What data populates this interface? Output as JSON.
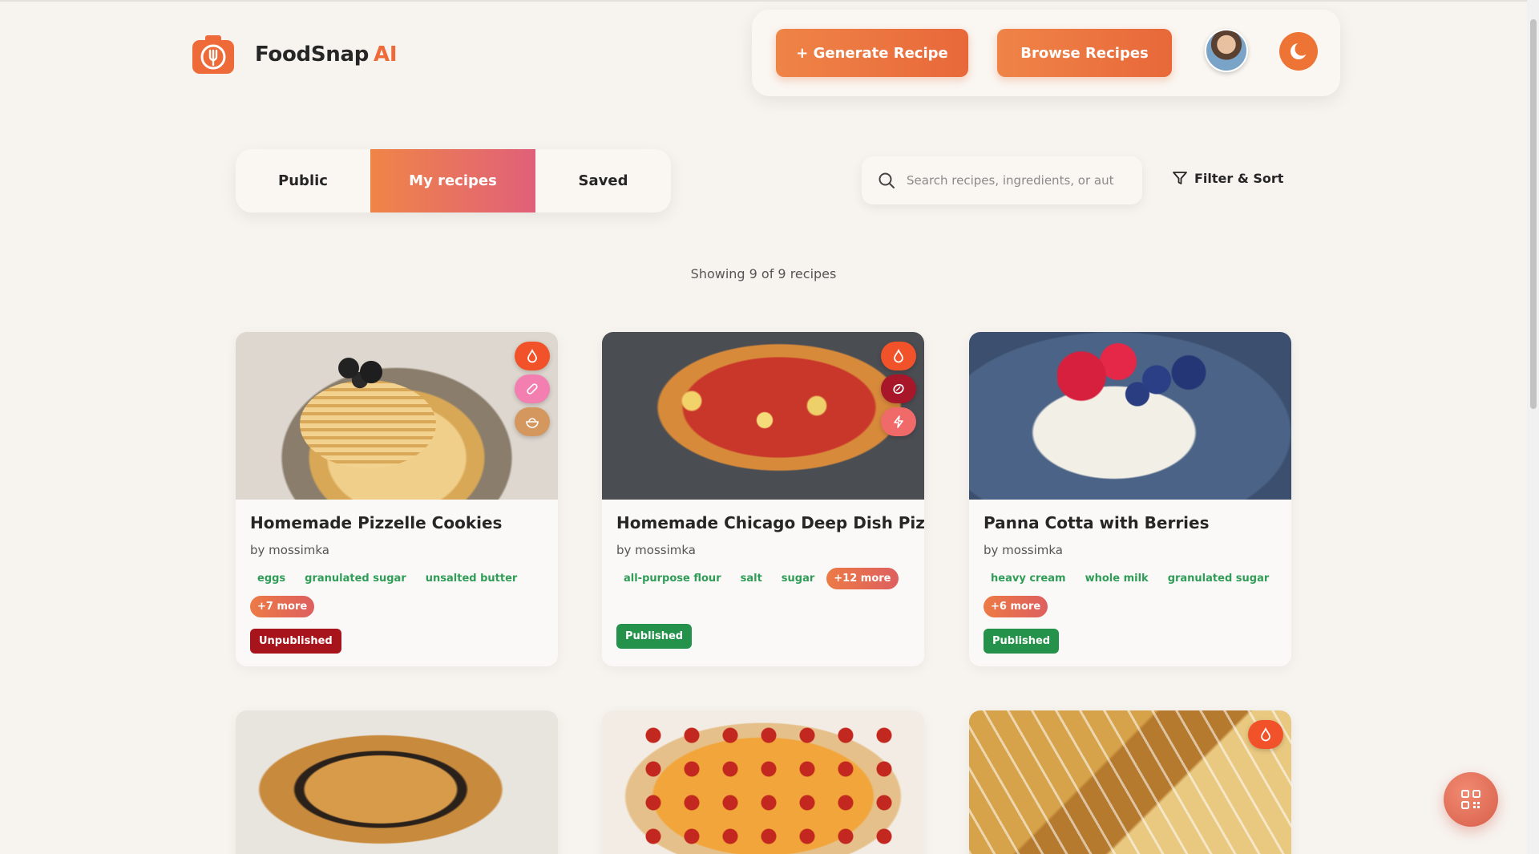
{
  "brand": {
    "name": "FoodSnap",
    "accent": "AI"
  },
  "header": {
    "generate_label": "+ Generate Recipe",
    "browse_label": "Browse Recipes"
  },
  "tabs": [
    {
      "label": "Public",
      "active": false
    },
    {
      "label": "My recipes",
      "active": true
    },
    {
      "label": "Saved",
      "active": false
    }
  ],
  "search": {
    "placeholder": "Search recipes, ingredients, or aut",
    "value": ""
  },
  "filter": {
    "label": "Filter & Sort"
  },
  "results": {
    "summary": "Showing 9 of 9 recipes"
  },
  "cards": [
    {
      "title": "Homemade Pizzelle Cookies",
      "author": "by mossimka",
      "tags": [
        "eggs",
        "granulated sugar",
        "unsalted butter"
      ],
      "more": "+7 more",
      "status": "Unpublished",
      "badges": [
        "drop-icon",
        "bandage-icon",
        "bowl-icon"
      ]
    },
    {
      "title": "Homemade Chicago Deep Dish Pizza",
      "author": "by mossimka",
      "tags": [
        "all-purpose flour",
        "salt",
        "sugar"
      ],
      "more": "+12 more",
      "status": "Published",
      "badges": [
        "drop-icon",
        "seed-icon",
        "bolt-icon"
      ]
    },
    {
      "title": "Panna Cotta with Berries",
      "author": "by mossimka",
      "tags": [
        "heavy cream",
        "whole milk",
        "granulated sugar"
      ],
      "more": "+6 more",
      "status": "Published",
      "badges": []
    }
  ],
  "colors": {
    "accent": "#ee6a38",
    "published": "#24924a",
    "unpublished": "#a8141b",
    "tag_text": "#2f9d57",
    "background": "#f7f3ef"
  }
}
